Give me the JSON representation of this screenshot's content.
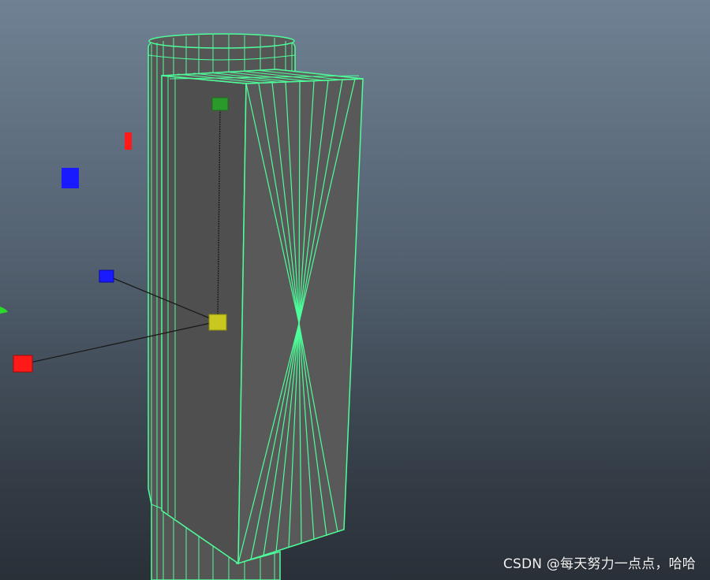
{
  "viewport": {
    "background_top": "#6f8193",
    "background_bottom": "#2a3038"
  },
  "colors": {
    "wireframe": "#4dff9a",
    "wireframe_dim": "#2fd97a",
    "mesh_fill": "#545454",
    "mesh_dark": "#484848",
    "handle_red": "#ff1a1a",
    "handle_blue": "#1a1aff",
    "handle_green": "#2a9a2a",
    "handle_yellow": "#c8c820"
  },
  "manipulator": {
    "center_icon": "pivot-center-icon",
    "x_icon": "red-axis-handle-icon",
    "y_icon": "green-axis-handle-icon",
    "z_icon": "blue-axis-handle-icon"
  },
  "watermark": {
    "text": "CSDN @每天努力一点点，哈哈"
  }
}
